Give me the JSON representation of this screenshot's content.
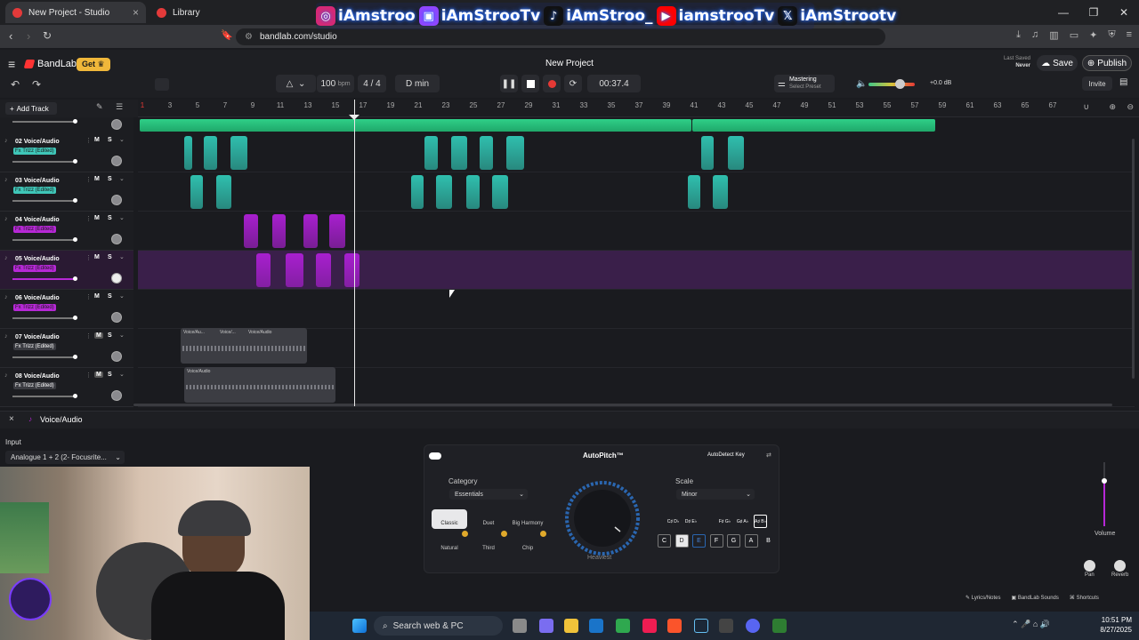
{
  "browser": {
    "tabs": [
      {
        "label": "New Project - Studio",
        "active": true
      },
      {
        "label": "Library",
        "active": false
      }
    ],
    "url": "bandlab.com/studio"
  },
  "overlay": {
    "handles": [
      {
        "icon": "instagram-icon",
        "text": "iAmstroo",
        "color": "#d62976"
      },
      {
        "icon": "twitch-icon",
        "text": "iAmStrooTv",
        "color": "#9146ff"
      },
      {
        "icon": "tiktok-icon",
        "text": "iAmStroo_",
        "color": "#111111"
      },
      {
        "icon": "youtube-icon",
        "text": "iamstrooTv",
        "color": "#ff0000"
      },
      {
        "icon": "x-icon",
        "text": "iAmStrootv",
        "color": "#111111"
      }
    ]
  },
  "app": {
    "logo": "BandLab",
    "get_label": "Get",
    "project_title": "New Project",
    "bpm": "100",
    "bpm_unit": "bpm",
    "time_sig": "4 / 4",
    "key": "D min",
    "time": "00:37.4",
    "mastering_title": "Mastering",
    "mastering_sub": "Select Preset",
    "gain": "+0.0 dB",
    "last_saved_label": "Last Saved",
    "last_saved_value": "Never",
    "save_label": "Save",
    "publish_label": "Publish",
    "invite_label": "Invite",
    "add_track_label": "Add Track"
  },
  "ruler": [
    "1",
    "3",
    "5",
    "7",
    "9",
    "11",
    "13",
    "15",
    "17",
    "19",
    "21",
    "23",
    "25",
    "27",
    "29",
    "31",
    "33",
    "35",
    "37",
    "39",
    "41",
    "43",
    "45",
    "47",
    "49",
    "51",
    "53",
    "55",
    "57",
    "59",
    "61",
    "63",
    "65",
    "67"
  ],
  "tracks": [
    {
      "name": "02  Voice/Audio",
      "fx": "Fx Trizz (Edited)",
      "fx_color": "#3fc6b8",
      "mute_active": false
    },
    {
      "name": "03  Voice/Audio",
      "fx": "Fx Trizz (Edited)",
      "fx_color": "#3fc6b8",
      "mute_active": false
    },
    {
      "name": "04  Voice/Audio",
      "fx": "Fx Trizz (Edited)",
      "fx_color": "#b628d6",
      "mute_active": false
    },
    {
      "name": "05  Voice/Audio",
      "fx": "Fx Trizz (Edited)",
      "fx_color": "#b628d6",
      "mute_active": false
    },
    {
      "name": "06  Voice/Audio",
      "fx": "Fx Trizz (Edited)",
      "fx_color": "#b628d6",
      "mute_active": false
    },
    {
      "name": "07  Voice/Audio",
      "fx": "Fx Trizz (Edited)",
      "fx_color": "#3b3c42",
      "mute_active": true
    },
    {
      "name": "08  Voice/Audio",
      "fx": "Fx Trizz (Edited)",
      "fx_color": "#3b3c42",
      "mute_active": true
    }
  ],
  "clip_labels": {
    "t7": [
      "Voice/Au...",
      "Voice/...",
      "Voice/Audio"
    ],
    "t8": [
      "Voice/Audio"
    ]
  },
  "panel": {
    "track_title": "Voice/Audio",
    "input_label": "Input",
    "input_value": "Analogue 1 + 2 (2- Focusrite...",
    "autopitch_title": "AutoPitch™",
    "autodetect_label": "AutoDetect Key",
    "category_label": "Category",
    "category_value": "Essentials",
    "scale_label": "Scale",
    "scale_value": "Minor",
    "knob_label": "Heaviest",
    "presets": [
      "Classic",
      "Duet",
      "Big Harmony",
      "Natural",
      "Third",
      "Chip"
    ],
    "keys_top": [
      "C♯ D♭",
      "D♯ E♭",
      "F♯ G♭",
      "G♯ A♭",
      "A♯ B♭"
    ],
    "keys_bottom": [
      "C",
      "D",
      "E",
      "F",
      "G",
      "A",
      "B"
    ],
    "volume_label": "Volume",
    "pan_label": "Pan",
    "reverb_label": "Reverb",
    "footer": [
      "Lyrics/Notes",
      "BandLab Sounds",
      "Shortcuts"
    ]
  },
  "taskbar": {
    "search_placeholder": "Search web & PC",
    "time": "10:51 PM",
    "date": "8/27/2025"
  }
}
